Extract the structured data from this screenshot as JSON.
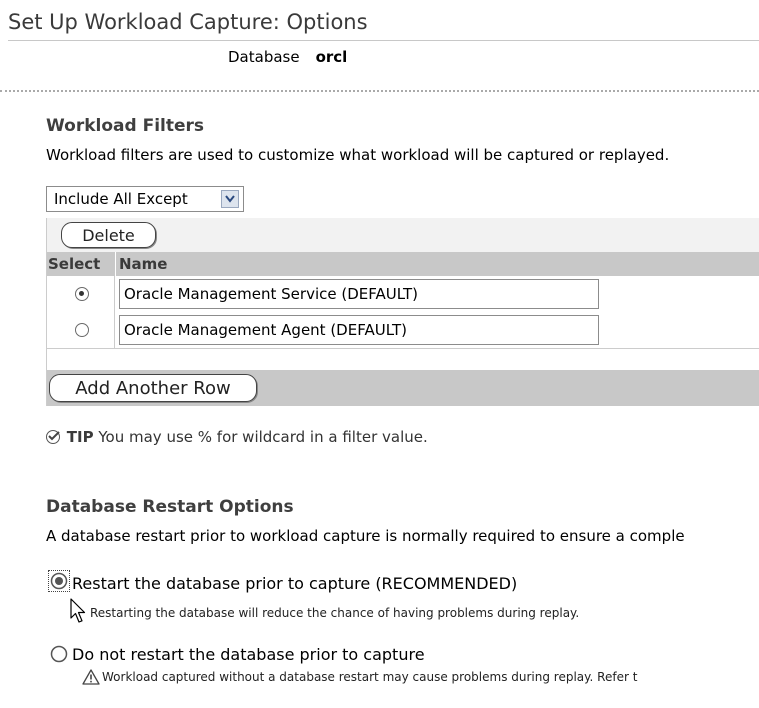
{
  "page": {
    "title": "Set Up Workload Capture: Options",
    "database_label": "Database",
    "database_value": "orcl"
  },
  "workload_filters": {
    "heading": "Workload Filters",
    "description": "Workload filters are used to customize what workload will be captured or replayed.",
    "filter_mode": "Include All Except",
    "delete_label": "Delete",
    "add_row_label": "Add Another Row",
    "columns": [
      "Select",
      "Name"
    ],
    "rows": [
      {
        "name": "Oracle Management Service (DEFAULT)",
        "selected": true
      },
      {
        "name": "Oracle Management Agent (DEFAULT)",
        "selected": false
      }
    ],
    "tip_label": "TIP",
    "tip_text": "You may use % for wildcard in a filter value."
  },
  "restart_options": {
    "heading": "Database Restart Options",
    "description": "A database restart prior to workload capture is normally required to ensure a comple",
    "options": [
      {
        "label": "Restart the database prior to capture (RECOMMENDED)",
        "hint": "Restarting the database will reduce the chance of having problems during replay.",
        "selected": true
      },
      {
        "label": "Do not restart the database prior to capture",
        "hint": "Workload captured without a database restart may cause problems during replay. Refer t",
        "selected": false
      }
    ]
  },
  "icons": {
    "dropdown": "chevron-down-icon",
    "tip": "check-circle-icon",
    "warning": "warning-icon",
    "cursor": "mouse-pointer-icon"
  }
}
